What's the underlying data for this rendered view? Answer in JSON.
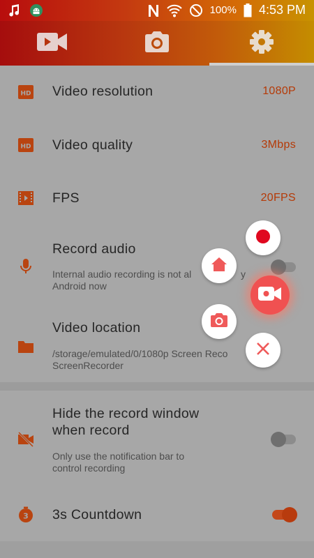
{
  "status_bar": {
    "battery": "100%",
    "time": "4:53 PM",
    "left_icons": [
      "music-note-icon",
      "android-debug-icon"
    ],
    "right_icons": [
      "n-notification-icon",
      "wifi-icon",
      "do-not-disturb-icon",
      "battery-icon"
    ]
  },
  "tabs": [
    {
      "icon": "video-camera-icon"
    },
    {
      "icon": "camera-icon"
    },
    {
      "icon": "gear-icon",
      "selected": true
    }
  ],
  "settings": {
    "video_resolution": {
      "title": "Video resolution",
      "value": "1080P",
      "icon": "hd-icon"
    },
    "video_quality": {
      "title": "Video quality",
      "value": "3Mbps",
      "icon": "hd-icon"
    },
    "fps": {
      "title": "FPS",
      "value": "20FPS",
      "icon": "film-icon"
    },
    "record_audio": {
      "title": "Record audio",
      "sub1": "Internal audio recording is not al",
      "sub1b": "y",
      "sub2": "Android now",
      "icon": "microphone-icon",
      "enabled": false
    },
    "video_location": {
      "title": "Video location",
      "sub1": "/storage/emulated/0/1080p Screen Reco",
      "sub2": "ScreenRecorder",
      "icon": "folder-icon"
    },
    "hide_window": {
      "title1": "Hide the record window",
      "title2": "when record",
      "sub1": "Only use the notification bar to",
      "sub2": "control recording",
      "icon": "video-off-icon",
      "enabled": false
    },
    "countdown": {
      "title": "3s Countdown",
      "icon": "timer-3-icon",
      "enabled": true
    }
  },
  "floating_menu": {
    "record": {
      "icon": "record-dot-icon"
    },
    "home": {
      "icon": "home-icon"
    },
    "main": {
      "icon": "video-camera-icon"
    },
    "screenshot": {
      "icon": "camera-icon"
    },
    "close": {
      "icon": "close-icon"
    }
  },
  "colors": {
    "accent": "#b53a07",
    "fab_red": "#f05151",
    "toggle_on": "#c4481a"
  }
}
